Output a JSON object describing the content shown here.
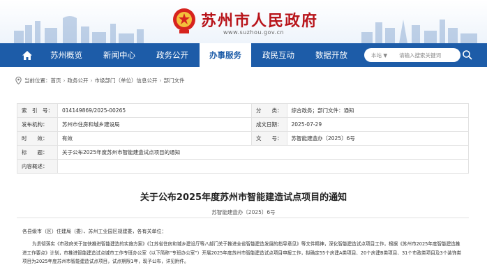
{
  "header": {
    "title": "苏州市人民政府",
    "url": "www.suzhou.gov.cn",
    "emblem_icon": "national-emblem-icon"
  },
  "nav": {
    "home_icon": "home-icon",
    "items": [
      {
        "label": "苏州概览"
      },
      {
        "label": "新闻中心"
      },
      {
        "label": "政务公开"
      },
      {
        "label": "办事服务"
      },
      {
        "label": "政民互动"
      },
      {
        "label": "数据开放"
      }
    ],
    "active_index": 3,
    "search": {
      "scope": "本站 ▼",
      "placeholder": "请输入搜索关键词",
      "icon": "search-icon"
    }
  },
  "breadcrumb": {
    "prefix": "当前位置：",
    "items": [
      "首页",
      "政务公开",
      "市级部门（单位）信息公开",
      "部门文件"
    ]
  },
  "info": {
    "index_label": "索　引　号：",
    "index_value": "014149869/2025-00265",
    "category_label": "分　　类：",
    "category_value": "综合政务；部门文件：通知",
    "issuer_label": "发布机构：",
    "issuer_value": "苏州市住房和城乡建设局",
    "date_label": "成文日期：",
    "date_value": "2025-07-29",
    "validity_label": "时　　效：",
    "validity_value": "有效",
    "docno_label": "文　　号：",
    "docno_value": "苏智能建造办〔2025〕6号",
    "subject_label": "标　　题：",
    "subject_value": "关于公布2025年度苏州市智能建造试点项目的通知",
    "summary_label": "内容概述：",
    "summary_value": ""
  },
  "article": {
    "title": "关于公布2025年度苏州市智能建造试点项目的通知",
    "docno": "苏智能建造办〔2025〕6号",
    "salutation": "各县级市（区）住建局（委）、苏州工业园区规建委，各有关单位：",
    "body": "为贯彻落实《市政府关于加快推进智能建造的实施方案》《江苏省住房和城乡建设厅等八部门关于推进全省智能建造发展的指导意见》等文件精神，深化智能建造试点项目工作，根据《苏州市2025年度智能建造推进工作要点》计划，市推进智能建造试点城市工作专班办公室（以下简称“专班办公室”）开展2025年度苏州市智能建造试点项目申报工作，拟确定55个房建A类项目、20个房建B类项目、31个市政类项目及3个装饰类项目为2025年度苏州市智能建造试点项目，试点期限1年，现予公布，详见附件。"
  },
  "colors": {
    "brand_red": "#b8141a",
    "nav_blue": "#1d5ca8"
  }
}
